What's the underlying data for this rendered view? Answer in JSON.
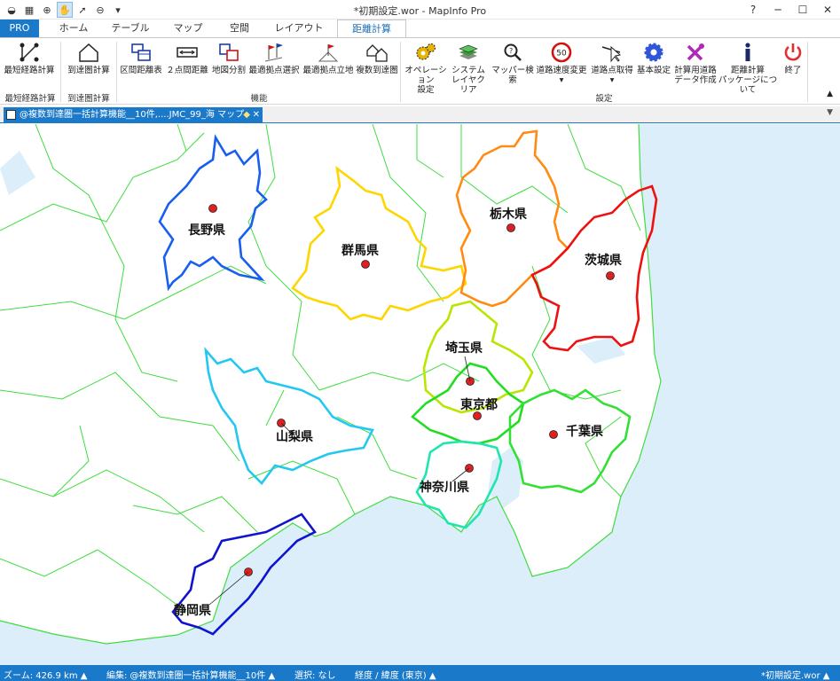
{
  "window": {
    "title": "*初期設定.wor - MapInfo Pro",
    "help": "?"
  },
  "tabs": [
    {
      "label": "PRO"
    },
    {
      "label": "ホーム"
    },
    {
      "label": "テーブル"
    },
    {
      "label": "マップ"
    },
    {
      "label": "空間"
    },
    {
      "label": "レイアウト"
    },
    {
      "label": "距離計算"
    }
  ],
  "ribbon": {
    "buttons": [
      {
        "label": "最短経路計算",
        "icon": "route-icon"
      },
      {
        "label": "到達圏計算",
        "icon": "house-icon"
      },
      {
        "label": "区間距離表",
        "icon": "table-icon"
      },
      {
        "label": "２点間距離",
        "icon": "ruler-icon"
      },
      {
        "label": "地図分割",
        "icon": "split-icon"
      },
      {
        "label": "最適拠点選択",
        "icon": "flags-icon"
      },
      {
        "label": "最適拠点立地",
        "icon": "site-icon"
      },
      {
        "label": "複数到達圏",
        "icon": "multi-house-icon"
      },
      {
        "label": "オペレーション",
        "label2": "設定",
        "icon": "gears-icon"
      },
      {
        "label": "システム",
        "label2": "レイヤクリア",
        "icon": "layers-icon"
      },
      {
        "label": "マッパー検索",
        "icon": "search-icon"
      },
      {
        "label": "道路速度変更",
        "icon": "speed-icon",
        "speed": "50"
      },
      {
        "label": "道路点取得",
        "icon": "cursor-icon"
      },
      {
        "label": "基本設定",
        "icon": "gear-icon"
      },
      {
        "label": "計算用道路",
        "label2": "データ作成",
        "icon": "tools-icon"
      },
      {
        "label": "距離計算",
        "label2": "パッケージについて",
        "icon": "info-icon"
      },
      {
        "label": "終了",
        "icon": "power-icon"
      }
    ],
    "groups": [
      {
        "label": "最短経路計算"
      },
      {
        "label": "到達圏計算"
      },
      {
        "label": "機能"
      },
      {
        "label": "設定"
      }
    ]
  },
  "document_tab": {
    "title": "@複数到達圏一括計算機能__10件,....JMC_99_海 マップ"
  },
  "map": {
    "colors": {
      "sea": "#dbeefa",
      "land": "#ffffff",
      "border": "#3fdc3f",
      "marker": "#e02020"
    },
    "prefectures": [
      {
        "name": "長野県",
        "color": "#1a5ef0"
      },
      {
        "name": "群馬県",
        "color": "#ffd500"
      },
      {
        "name": "栃木県",
        "color": "#ff8a14"
      },
      {
        "name": "茨城県",
        "color": "#ee1111"
      },
      {
        "name": "埼玉県",
        "color": "#b8e600"
      },
      {
        "name": "東京都",
        "color": "#22dd22"
      },
      {
        "name": "千葉県",
        "color": "#33e033"
      },
      {
        "name": "山梨県",
        "color": "#22c8f0"
      },
      {
        "name": "神奈川県",
        "color": "#1fe6b0"
      },
      {
        "name": "静岡県",
        "color": "#1014cc"
      }
    ]
  },
  "status": {
    "zoom": "ズーム: 426.9 km",
    "edit": "編集: @複数到達圏一括計算機能__10件",
    "select": "選択: なし",
    "coords": "経度 / 緯度 (東京)",
    "workspace": "*初期設定.wor"
  }
}
